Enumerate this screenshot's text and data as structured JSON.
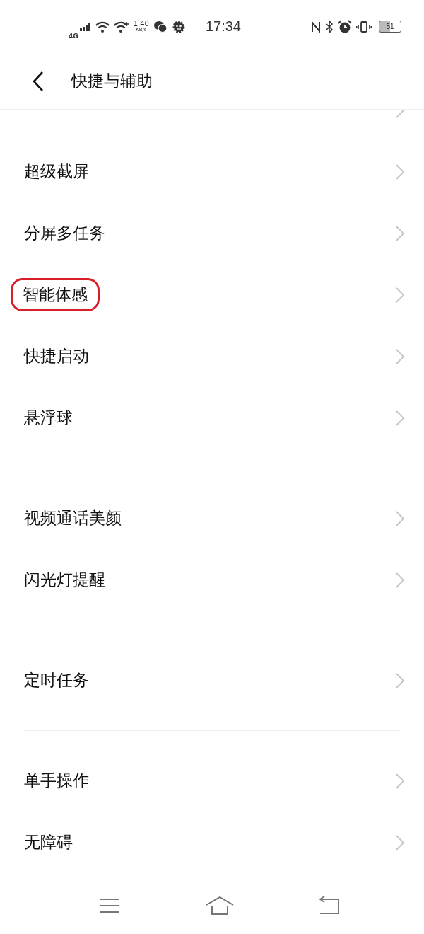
{
  "status_bar": {
    "network": "4G",
    "speed_value": "1.40",
    "speed_unit": "KB/s",
    "time": "17:34",
    "battery": "51"
  },
  "header": {
    "title": "快捷与辅助"
  },
  "groups": [
    {
      "items": [
        {
          "highlighted": false
        },
        {
          "label": "超级截屏",
          "highlighted": false
        },
        {
          "label": "分屏多任务",
          "highlighted": false
        },
        {
          "label": "智能体感",
          "highlighted": true
        },
        {
          "label": "快捷启动",
          "highlighted": false
        },
        {
          "label": "悬浮球",
          "highlighted": false
        }
      ]
    },
    {
      "items": [
        {
          "label": "视频通话美颜",
          "highlighted": false
        },
        {
          "label": "闪光灯提醒",
          "highlighted": false
        }
      ]
    },
    {
      "items": [
        {
          "label": "定时任务",
          "highlighted": false
        }
      ]
    },
    {
      "items": [
        {
          "label": "单手操作",
          "highlighted": false
        },
        {
          "label": "无障碍",
          "highlighted": false
        }
      ]
    }
  ]
}
